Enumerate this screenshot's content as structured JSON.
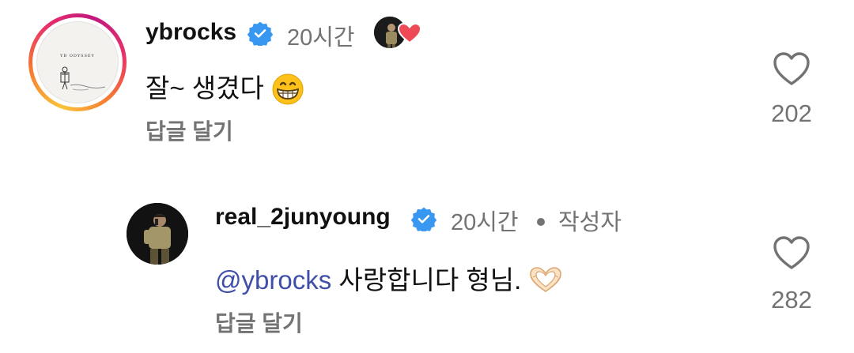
{
  "comments": [
    {
      "username": "ybrocks",
      "time": "20시간",
      "text": "잘~ 생겼다",
      "emoji": "grinning-face",
      "reply_label": "답글 달기",
      "likes": "202",
      "avatar_text": "YB ODYSSEY",
      "liked_by_author": true
    },
    {
      "username": "real_2junyoung",
      "time": "20시간",
      "author_label": "작성자",
      "mention": "@ybrocks",
      "text": "사랑합니다 형님.",
      "emoji": "heart-hands",
      "reply_label": "답글 달기",
      "likes": "282"
    }
  ],
  "colors": {
    "secondary_text": "#737373",
    "mention": "#3f4fa8",
    "verified": "#3897f0",
    "heart_badge": "#ed4956"
  }
}
